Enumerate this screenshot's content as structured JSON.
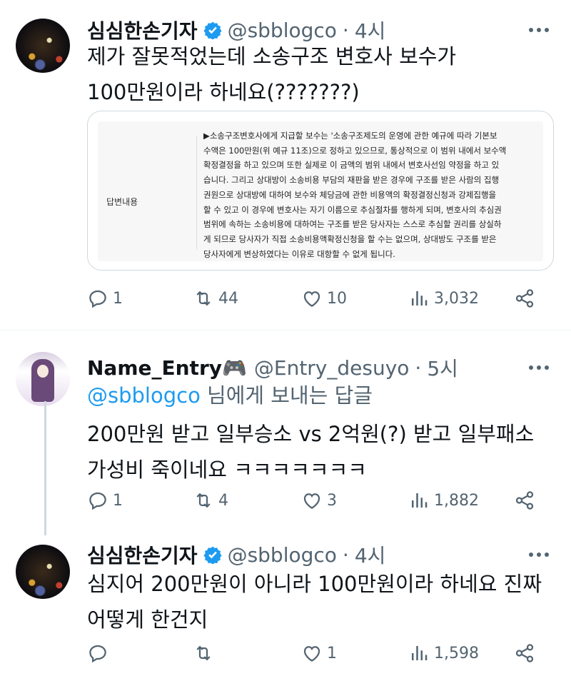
{
  "tweets": [
    {
      "name": "심심한손기자",
      "handle": "@sbblogco",
      "time": "4시",
      "lines": [
        "제가 잘못적었는데 소송구조 변호사 보수가",
        "100만원이라 하네요(???????)"
      ],
      "card": {
        "label": "답변내용",
        "lines": [
          "▶소송구조변호사에게 지급할 보수는 '소송구조제도의 운영에 관한 예규에 따라 기본보",
          "수액은 100만원(위 예규 11조)으로 정하고 있으므로, 통상적으로 이 범위 내에서 보수액",
          "확정결정을 하고 있으며 또한 실제로 이 금액의 범위 내에서 변호사선임 약정을 하고 있",
          "습니다. 그리고 상대방이 소송비용 부담의 재판을 받은 경우에 구조를 받은 사람의 집행",
          "권원으로 상대방에 대하여 보수와 체당금에 관한 비용액의 확정결정신청과 강제집행을",
          "할 수 있고 이 경우에 변호사는 자기 이름으로 추심절차를 행하게 되며, 변호사의 추심권",
          "범위에 속하는 소송비용에 대하여는 구조를 받은 당사자는 스스로 추심할 권리를 상실하",
          "게 되므로 당사자가 직접 소송비용액확정신청을 할 수는 없으며, 상대방도 구조를 받은",
          "당사자에게 변상하였다는 이유로 대항할 수 없게 됩니다."
        ]
      },
      "replies": "1",
      "retweets": "44",
      "likes": "10",
      "views": "3,032"
    },
    {
      "name": "Name_Entry🎮",
      "handle": "@Entry_desuyo",
      "time": "5시",
      "reply_to_mention": "@sbblogco",
      "reply_to_suffix": " 님에게 보내는 답글",
      "lines": [
        "200만원 받고 일부승소 vs 2억원(?) 받고 일부패소",
        "가성비 죽이네요 ㅋㅋㅋㅋㅋㅋㅋ"
      ],
      "replies": "1",
      "retweets": "4",
      "likes": "3",
      "views": "1,882"
    },
    {
      "name": "심심한손기자",
      "handle": "@sbblogco",
      "time": "4시",
      "lines": [
        "심지어 200만원이 아니라 100만원이라 하네요 진짜",
        "어떻게 한건지"
      ],
      "replies": "",
      "retweets": "",
      "likes": "1",
      "views": "1,598"
    }
  ],
  "separator_dot": "·",
  "icons": [
    "reply-icon",
    "retweet-icon",
    "like-icon",
    "views-icon",
    "share-icon",
    "more-icon",
    "verified-badge-icon"
  ],
  "colors": {
    "accent": "#1d9bf0",
    "muted": "#536471",
    "text": "#0f1419",
    "border": "#cfd9de"
  }
}
